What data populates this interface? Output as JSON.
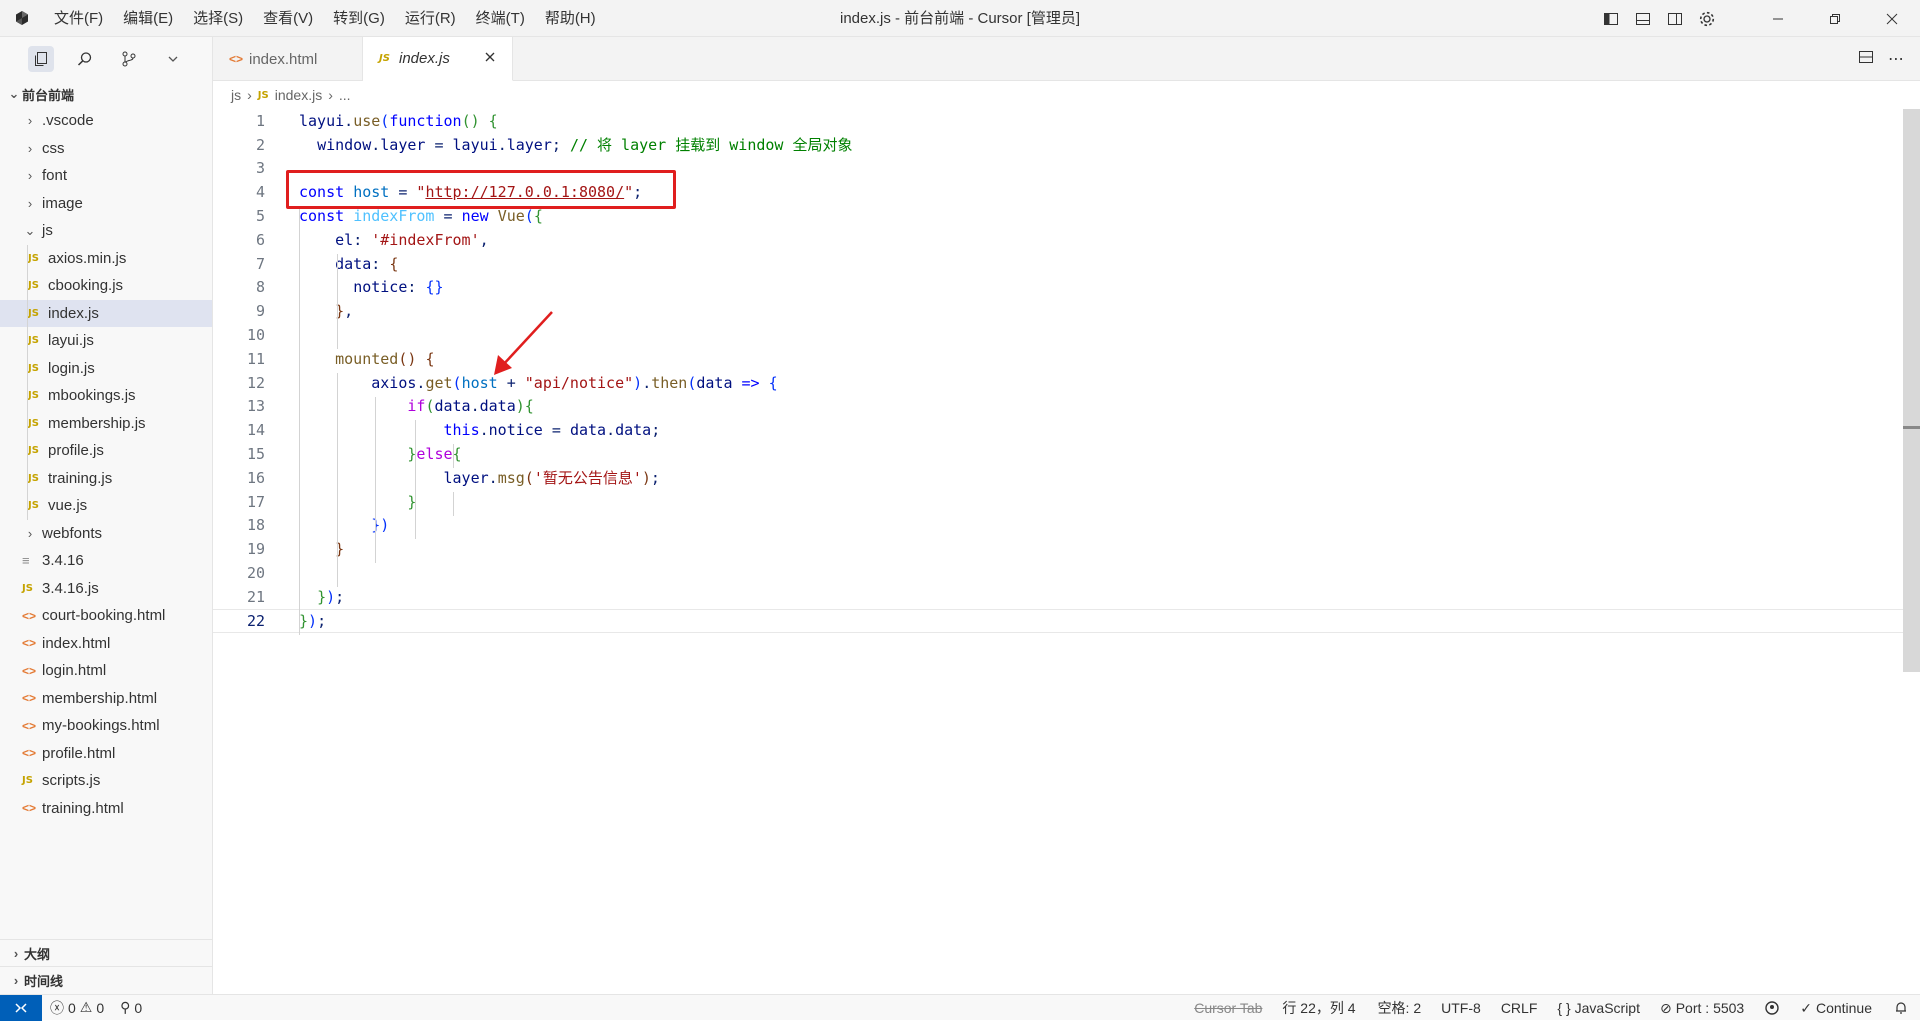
{
  "titlebar": {
    "menus": [
      "文件(F)",
      "编辑(E)",
      "选择(S)",
      "查看(V)",
      "转到(G)",
      "运行(R)",
      "终端(T)",
      "帮助(H)"
    ],
    "title": "index.js - 前台前端 - Cursor [管理员]"
  },
  "sidebar": {
    "root": "前台前端",
    "items": [
      {
        "label": ".vscode",
        "type": "folder"
      },
      {
        "label": "css",
        "type": "folder"
      },
      {
        "label": "font",
        "type": "folder"
      },
      {
        "label": "image",
        "type": "folder"
      },
      {
        "label": "js",
        "type": "folder-open"
      },
      {
        "label": "axios.min.js",
        "type": "js",
        "nested": true
      },
      {
        "label": "cbooking.js",
        "type": "js",
        "nested": true
      },
      {
        "label": "index.js",
        "type": "js",
        "nested": true,
        "selected": true
      },
      {
        "label": "layui.js",
        "type": "js",
        "nested": true
      },
      {
        "label": "login.js",
        "type": "js",
        "nested": true
      },
      {
        "label": "mbookings.js",
        "type": "js",
        "nested": true
      },
      {
        "label": "membership.js",
        "type": "js",
        "nested": true
      },
      {
        "label": "profile.js",
        "type": "js",
        "nested": true
      },
      {
        "label": "training.js",
        "type": "js",
        "nested": true
      },
      {
        "label": "vue.js",
        "type": "js",
        "nested": true
      },
      {
        "label": "webfonts",
        "type": "folder"
      },
      {
        "label": "3.4.16",
        "type": "txt"
      },
      {
        "label": "3.4.16.js",
        "type": "js"
      },
      {
        "label": "court-booking.html",
        "type": "html"
      },
      {
        "label": "index.html",
        "type": "html"
      },
      {
        "label": "login.html",
        "type": "html"
      },
      {
        "label": "membership.html",
        "type": "html"
      },
      {
        "label": "my-bookings.html",
        "type": "html"
      },
      {
        "label": "profile.html",
        "type": "html"
      },
      {
        "label": "scripts.js",
        "type": "js"
      },
      {
        "label": "training.html",
        "type": "html"
      }
    ],
    "outline": "大纲",
    "timeline": "时间线"
  },
  "tabs": [
    {
      "label": "index.html",
      "type": "html",
      "active": false
    },
    {
      "label": "index.js",
      "type": "js",
      "active": true
    }
  ],
  "breadcrumb": {
    "folder": "js",
    "file": "index.js",
    "more": "..."
  },
  "editor": {
    "current_line": 22,
    "lines": [
      "layui.use(function() {",
      "  window.layer = layui.layer; // 将 layer 挂载到 window 全局对象",
      "",
      "const host = \"http://127.0.0.1:8080/\";",
      "const indexFrom = new Vue({",
      "    el: '#indexFrom',",
      "    data: {",
      "      notice: {}",
      "    },",
      "",
      "    mounted() {",
      "        axios.get(host + \"api/notice\").then(data => {",
      "            if(data.data){",
      "                this.notice = data.data;",
      "            }else{",
      "                layer.msg('暂无公告信息');",
      "            }",
      "        })",
      "    }",
      "",
      "  });",
      "});"
    ]
  },
  "statusbar": {
    "errors": "0",
    "warnings": "0",
    "ports": "0",
    "cursor_tab": "Cursor Tab",
    "position": "行 22，列 4",
    "spaces": "空格: 2",
    "encoding": "UTF-8",
    "eol": "CRLF",
    "language": "JavaScript",
    "port": "Port : 5503",
    "continue": "Continue"
  }
}
